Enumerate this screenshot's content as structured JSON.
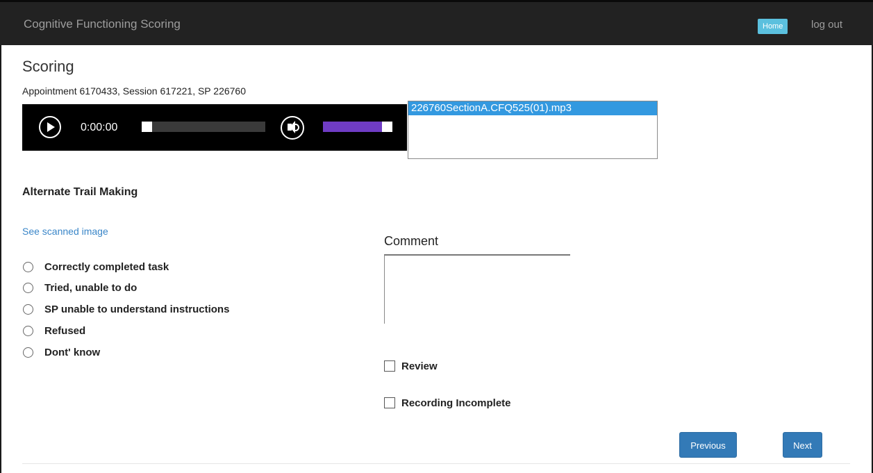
{
  "navbar": {
    "brand": "Cognitive Functioning Scoring",
    "home_label": "Home",
    "logout_label": "log out"
  },
  "page": {
    "title": "Scoring",
    "subtitle": "Appointment 6170433, Session 617221, SP 226760"
  },
  "player": {
    "time": "0:00:00",
    "progress": 0,
    "volume": 1.0,
    "volume_color": "#6f3cc4"
  },
  "files": {
    "items": [
      "226760SectionA.CFQ525(01).mp3"
    ],
    "selected": "226760SectionA.CFQ525(01).mp3"
  },
  "section": {
    "title": "Alternate Trail Making",
    "scan_link": "See scanned image",
    "options": [
      "Correctly completed task",
      "Tried, unable to do",
      "SP unable to understand instructions",
      "Refused",
      "Dont' know"
    ]
  },
  "comment": {
    "label": "Comment",
    "value": ""
  },
  "checks": {
    "review": "Review",
    "recording_incomplete": "Recording Incomplete"
  },
  "buttons": {
    "previous": "Previous",
    "next": "Next"
  },
  "colors": {
    "navbar_bg": "#222222",
    "home_btn": "#5bc0de",
    "primary_btn": "#337ab7",
    "link": "#3a86c8",
    "file_selected": "#3399e0"
  }
}
